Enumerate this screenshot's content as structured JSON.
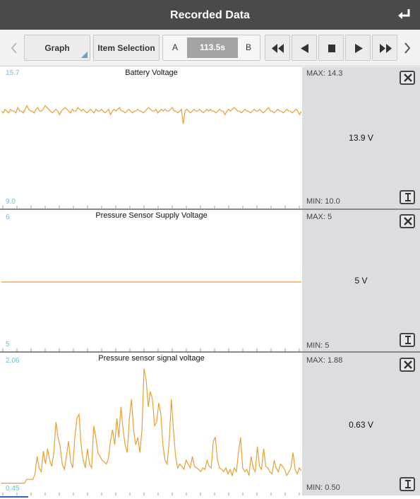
{
  "header": {
    "title": "Recorded Data",
    "back_icon": "return-arrow-icon"
  },
  "toolbar": {
    "graph_label": "Graph",
    "item_selection_label": "Item Selection",
    "marker_a": "A",
    "marker_b": "B",
    "time": "113.5s",
    "controls": [
      "rewind-icon",
      "step-back-icon",
      "stop-icon",
      "play-icon",
      "fast-forward-icon"
    ]
  },
  "colors": {
    "trace": "#e8a030",
    "axis_label": "#62c6d8",
    "side_panel": "#dcdde1",
    "header": "#4a4a4a"
  },
  "panels": [
    {
      "title": "Battery Voltage",
      "y_max": "15.7",
      "y_min": "9.0",
      "max_label": "MAX: 14.3",
      "min_label": "MIN: 10.0",
      "value": "13.9 V"
    },
    {
      "title": "Pressure Sensor Supply Voltage",
      "y_max": "6",
      "y_min": "5",
      "max_label": "MAX: 5",
      "min_label": "MIN: 5",
      "value": "5 V"
    },
    {
      "title": "Pressure sensor signal voltage",
      "y_max": "2.06",
      "y_min": "0.45",
      "max_label": "MAX: 1.88",
      "min_label": "MIN: 0.50",
      "value": "0.63 V"
    }
  ],
  "chart_data": [
    {
      "type": "line",
      "title": "Battery Voltage",
      "ylim": [
        9.0,
        15.7
      ],
      "values": [
        13.9,
        13.8,
        14.0,
        13.9,
        13.8,
        14.0,
        13.9,
        13.9,
        13.8,
        14.1,
        13.9,
        13.9,
        13.8,
        14.0,
        14.2,
        14.0,
        13.9,
        13.9,
        13.8,
        14.0,
        14.1,
        13.9,
        13.9,
        14.0,
        14.2,
        14.1,
        14.0,
        13.9,
        13.8,
        13.9,
        14.0,
        13.9,
        13.7,
        13.9,
        14.0,
        14.1,
        14.0,
        13.9,
        13.8,
        14.0,
        13.9,
        13.9,
        14.1,
        14.0,
        13.9,
        14.0,
        13.9,
        13.8,
        13.9,
        14.0,
        13.9,
        13.8,
        14.0,
        13.9,
        13.9,
        14.0,
        13.9,
        13.8,
        13.9,
        14.0,
        13.7,
        13.9,
        14.0,
        13.9,
        14.0,
        14.1,
        13.9,
        13.9,
        13.8,
        13.9,
        14.0,
        13.9,
        13.8,
        13.9,
        13.9,
        14.0,
        13.9,
        13.9,
        13.8,
        13.9,
        14.0,
        14.1,
        14.0,
        13.9,
        13.9,
        14.0,
        13.8,
        13.9,
        14.0,
        13.9,
        14.0,
        13.9,
        13.9,
        14.0,
        14.1,
        13.9,
        13.9,
        13.8,
        13.9,
        14.0,
        13.2,
        13.9,
        14.0,
        13.9,
        13.8,
        13.9,
        14.0,
        13.9,
        13.9,
        14.0,
        13.9,
        13.8,
        13.9,
        14.0,
        13.9,
        14.0,
        13.9,
        13.9,
        13.8,
        13.9,
        14.0,
        13.9,
        13.9,
        13.7,
        13.9,
        14.0,
        13.9,
        14.0,
        14.1,
        14.0,
        13.9,
        13.9,
        13.8,
        13.9,
        14.0,
        13.9,
        13.9,
        13.8,
        13.9,
        14.0,
        13.9,
        13.9,
        14.0,
        13.9,
        13.8,
        13.9,
        14.0,
        14.1,
        13.9,
        13.9,
        13.8,
        13.9,
        14.0,
        13.9,
        13.9,
        13.8,
        13.9,
        14.0,
        13.9,
        13.9,
        13.8,
        13.9,
        14.0,
        13.9,
        13.7,
        13.9
      ]
    },
    {
      "type": "line",
      "title": "Pressure Sensor Supply Voltage",
      "ylim": [
        5,
        6
      ],
      "values": [
        5.5,
        5.5,
        5.5,
        5.5,
        5.5,
        5.5,
        5.5,
        5.5,
        5.5,
        5.5
      ]
    },
    {
      "type": "line",
      "title": "Pressure sensor signal voltage",
      "ylim": [
        0.45,
        2.06
      ],
      "values": [
        0.5,
        0.5,
        0.5,
        0.5,
        0.5,
        0.5,
        0.5,
        0.5,
        0.5,
        0.5,
        0.5,
        0.5,
        0.55,
        0.55,
        0.55,
        0.55,
        0.62,
        0.85,
        0.7,
        0.65,
        0.92,
        0.75,
        0.95,
        0.8,
        0.72,
        0.9,
        1.3,
        1.1,
        0.98,
        0.75,
        0.68,
        0.85,
        1.05,
        0.78,
        0.7,
        1.1,
        1.35,
        1.4,
        1.0,
        0.8,
        0.7,
        0.95,
        0.75,
        0.7,
        1.25,
        1.1,
        0.9,
        0.85,
        0.8,
        0.78,
        0.75,
        0.82,
        1.05,
        1.2,
        1.0,
        1.35,
        1.1,
        1.5,
        1.2,
        1.0,
        0.9,
        1.35,
        1.6,
        1.2,
        1.0,
        1.1,
        0.9,
        1.2,
        2.0,
        1.85,
        1.5,
        1.7,
        1.6,
        1.25,
        1.3,
        1.55,
        1.4,
        1.0,
        0.8,
        0.75,
        1.05,
        1.6,
        1.2,
        0.85,
        0.7,
        0.75,
        0.72,
        0.68,
        0.8,
        0.75,
        0.7,
        0.85,
        0.72,
        0.7,
        0.68,
        0.65,
        0.7,
        0.68,
        0.8,
        0.72,
        0.7,
        1.05,
        1.1,
        0.8,
        0.7,
        0.68,
        0.65,
        0.7,
        0.62,
        0.68,
        0.6,
        0.7,
        0.65,
        0.9,
        1.1,
        0.7,
        0.65,
        0.68,
        0.6,
        0.85,
        0.7,
        0.65,
        0.98,
        0.72,
        0.68,
        0.95,
        0.72,
        0.7,
        0.65,
        0.62,
        0.8,
        0.7,
        0.65,
        0.75,
        0.72,
        0.68,
        0.6,
        0.65,
        0.7,
        0.9,
        0.68,
        0.62,
        0.7,
        0.66
      ]
    }
  ]
}
